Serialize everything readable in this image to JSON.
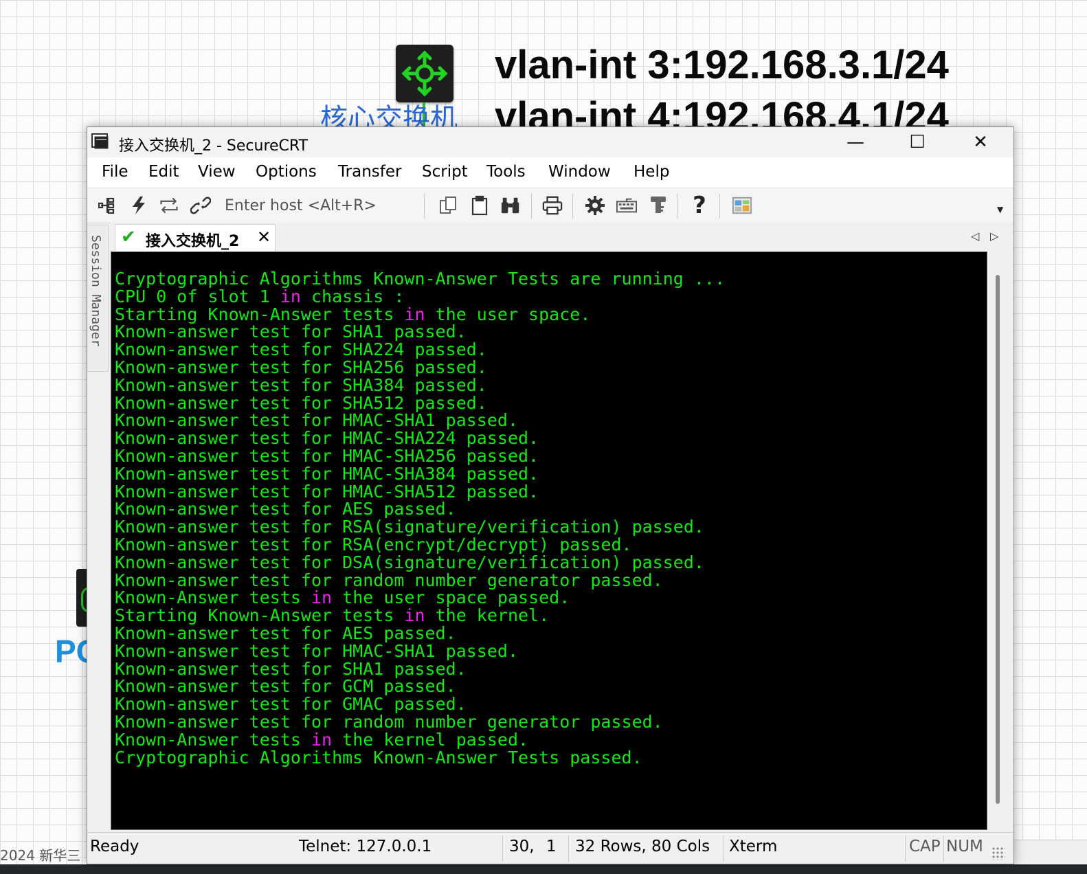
{
  "background": {
    "vlan_lines": [
      "vlan-int 3:192.168.3.1/24",
      "vlan-int 4:192.168.4.1/24"
    ],
    "device_label": "核心交换机",
    "pc_label": "PC",
    "copyright": "2024 新华三"
  },
  "window": {
    "title": "接入交换机_2 - SecureCRT",
    "min_glyph": "—",
    "max_glyph": "☐",
    "close_glyph": "✕"
  },
  "menu": [
    "File",
    "Edit",
    "View",
    "Options",
    "Transfer",
    "Script",
    "Tools",
    "Window",
    "Help"
  ],
  "toolbar": {
    "host_placeholder": "Enter host <Alt+R>",
    "icons": [
      "connect-icon",
      "quick-connect-icon",
      "reconnect-icon",
      "disconnect-icon",
      "copy-icon",
      "paste-icon",
      "find-icon",
      "print-icon",
      "settings-icon",
      "keymap-icon",
      "keys-icon",
      "help-icon",
      "sftp-icon"
    ]
  },
  "side_panel": {
    "label": "Session Manager"
  },
  "tab": {
    "label": "接入交换机_2",
    "check": "✔",
    "close": "✕"
  },
  "terminal": {
    "keyword_color": "#ee22ee",
    "text_color": "#14e814",
    "lines": [
      "Cryptographic Algorithms Known-Answer Tests are running ...",
      "CPU 0 of slot 1 in chassis :",
      "Starting Known-Answer tests in the user space.",
      "Known-answer test for SHA1 passed.",
      "Known-answer test for SHA224 passed.",
      "Known-answer test for SHA256 passed.",
      "Known-answer test for SHA384 passed.",
      "Known-answer test for SHA512 passed.",
      "Known-answer test for HMAC-SHA1 passed.",
      "Known-answer test for HMAC-SHA224 passed.",
      "Known-answer test for HMAC-SHA256 passed.",
      "Known-answer test for HMAC-SHA384 passed.",
      "Known-answer test for HMAC-SHA512 passed.",
      "Known-answer test for AES passed.",
      "Known-answer test for RSA(signature/verification) passed.",
      "Known-answer test for RSA(encrypt/decrypt) passed.",
      "Known-answer test for DSA(signature/verification) passed.",
      "Known-answer test for random number generator passed.",
      "Known-Answer tests in the user space passed.",
      "Starting Known-Answer tests in the kernel.",
      "Known-answer test for AES passed.",
      "Known-answer test for HMAC-SHA1 passed.",
      "Known-answer test for SHA1 passed.",
      "Known-answer test for GCM passed.",
      "Known-answer test for GMAC passed.",
      "Known-answer test for random number generator passed.",
      "Known-Answer tests in the kernel passed.",
      "Cryptographic Algorithms Known-Answer Tests passed."
    ]
  },
  "status": {
    "state": "Ready",
    "connection": "Telnet: 127.0.0.1",
    "cursor_row": "30,",
    "cursor_col": "1",
    "size": "32 Rows, 80 Cols",
    "emulation": "Xterm",
    "cap": "CAP",
    "num": "NUM"
  }
}
